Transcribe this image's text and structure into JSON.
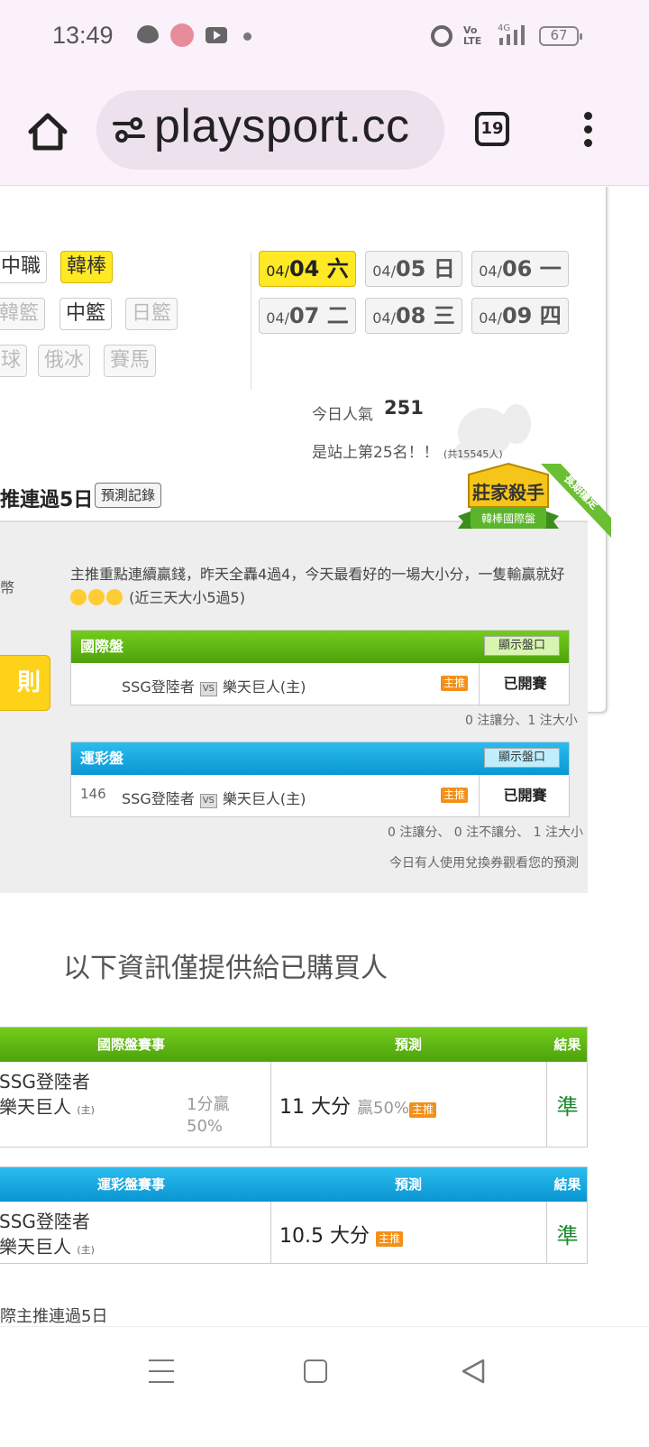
{
  "status_bar": {
    "time": "13:49",
    "battery": "67",
    "network": "4G",
    "volte": "Vo LTE"
  },
  "browser": {
    "url": "playsport.cc",
    "tab_count": "19"
  },
  "leagues": {
    "row1": [
      "中職",
      "韓棒"
    ],
    "row2": [
      "韓籃",
      "中籃",
      "日籃"
    ],
    "row3": [
      "球",
      "俄冰",
      "賽馬"
    ]
  },
  "dates": [
    {
      "md": "04/",
      "day": "04 六"
    },
    {
      "md": "04/",
      "day": "05 日"
    },
    {
      "md": "04/",
      "day": "06 一"
    },
    {
      "md": "04/",
      "day": "07 二"
    },
    {
      "md": "04/",
      "day": "08 三"
    },
    {
      "md": "04/",
      "day": "09 四"
    }
  ],
  "popularity": {
    "label": "今日人氣",
    "value": "251",
    "rank_text": "是站上第25名！！",
    "rank_total": "(共15545人)"
  },
  "streak": {
    "title": "推連過5日",
    "record_button": "預測記錄"
  },
  "badge": {
    "main": "莊家殺手",
    "sub": "韓棒國際盤",
    "ribbon": "長期穩定"
  },
  "side": {
    "coin": "幣",
    "button": "則"
  },
  "description": {
    "text": "主推重點連續贏錢，昨天全轟4過4，今天最看好的一場大小分，一隻輸贏就好",
    "tail": "(近三天大小5過5)"
  },
  "intl_table": {
    "title": "國際盤",
    "show_btn": "顯示盤口",
    "num": "",
    "away": "SSG登陸者",
    "vs": "VS",
    "home": "樂天巨人(主)",
    "tag": "主推",
    "status": "已開賽",
    "counts": "0 注讓分、1 注大小"
  },
  "sports_table": {
    "title": "運彩盤",
    "show_btn": "顯示盤口",
    "num": "146",
    "away": "SSG登陸者",
    "vs": "VS",
    "home": "樂天巨人(主)",
    "tag": "主推",
    "status": "已開賽",
    "counts": "0 注讓分、 0 注不讓分、 1 注大小"
  },
  "notice": "今日有人使用兌換券觀看您的預測",
  "buyers_heading": "以下資訊僅提供給已購買人",
  "result_intl": {
    "h1": "國際盤賽事",
    "h2": "預測",
    "h3": "結果",
    "team1": "SSG登陸者",
    "team2": "樂天巨人",
    "home_mark": "(主)",
    "handicap1": "1分贏",
    "handicap2": "50%",
    "prediction": "11 大分",
    "winrate": "贏50%",
    "tag": "主推",
    "result": "準"
  },
  "result_sports": {
    "h1": "運彩盤賽事",
    "h2": "預測",
    "h3": "結果",
    "team1": "SSG登陸者",
    "team2": "樂天巨人",
    "home_mark": "(主)",
    "prediction": "10.5 大分",
    "tag": "主推",
    "result": "準"
  },
  "footer_note": "際主推連過5日"
}
